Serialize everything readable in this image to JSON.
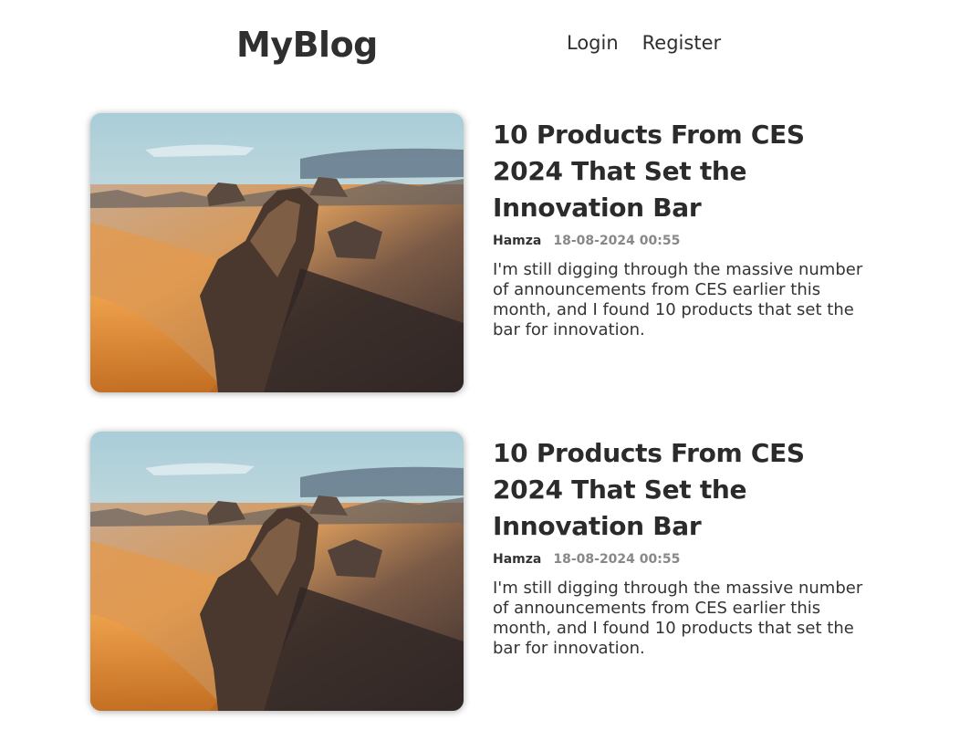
{
  "header": {
    "logo": "MyBlog",
    "nav": {
      "login": "Login",
      "register": "Register"
    }
  },
  "posts": [
    {
      "title": "10 Products From CES 2024 That Set the Innovation Bar",
      "author": "Hamza",
      "datetime": "18-08-2024 00:55",
      "summary": "I'm still digging through the massive number of announcements from CES earlier this month, and I found 10 products that set the bar for innovation."
    },
    {
      "title": "10 Products From CES 2024 That Set the Innovation Bar",
      "author": "Hamza",
      "datetime": "18-08-2024 00:55",
      "summary": "I'm still digging through the massive number of announcements from CES earlier this month, and I found 10 products that set the bar for innovation."
    }
  ],
  "colors": {
    "text": "#333333",
    "muted": "#888888",
    "background": "#ffffff"
  }
}
